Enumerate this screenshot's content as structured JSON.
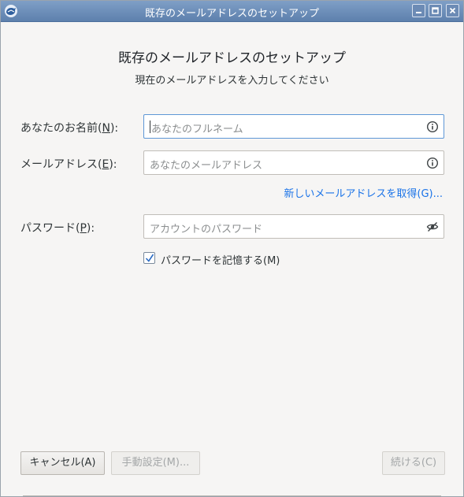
{
  "window": {
    "title": "既存のメールアドレスのセットアップ",
    "controls": [
      "minimize-icon",
      "maximize-icon",
      "close-icon"
    ]
  },
  "header": {
    "title": "既存のメールアドレスのセットアップ",
    "subtitle": "現在のメールアドレスを入力してください"
  },
  "form": {
    "name": {
      "label_pre": "あなたのお名前(",
      "accesskey": "N",
      "label_post": "):",
      "placeholder": "あなたのフルネーム",
      "value": "",
      "icon": "info-icon"
    },
    "email": {
      "label_pre": "メールアドレス(",
      "accesskey": "E",
      "label_post": "):",
      "placeholder": "あなたのメールアドレス",
      "value": "",
      "icon": "info-icon"
    },
    "new_address_link": "新しいメールアドレスを取得(G)...",
    "password": {
      "label_pre": "パスワード(",
      "accesskey": "P",
      "label_post": "):",
      "placeholder": "アカウントのパスワード",
      "value": "",
      "icon": "eye-slash-icon"
    },
    "remember": {
      "label": "パスワードを記憶する(M)",
      "checked": true
    }
  },
  "buttons": {
    "cancel": "キャンセル(A)",
    "manual": "手動設定(M)...",
    "continue": "続ける(C)"
  },
  "colors": {
    "titlebar": "#6f90bb",
    "link": "#1a73e8",
    "focus_border": "#5e97d6"
  }
}
